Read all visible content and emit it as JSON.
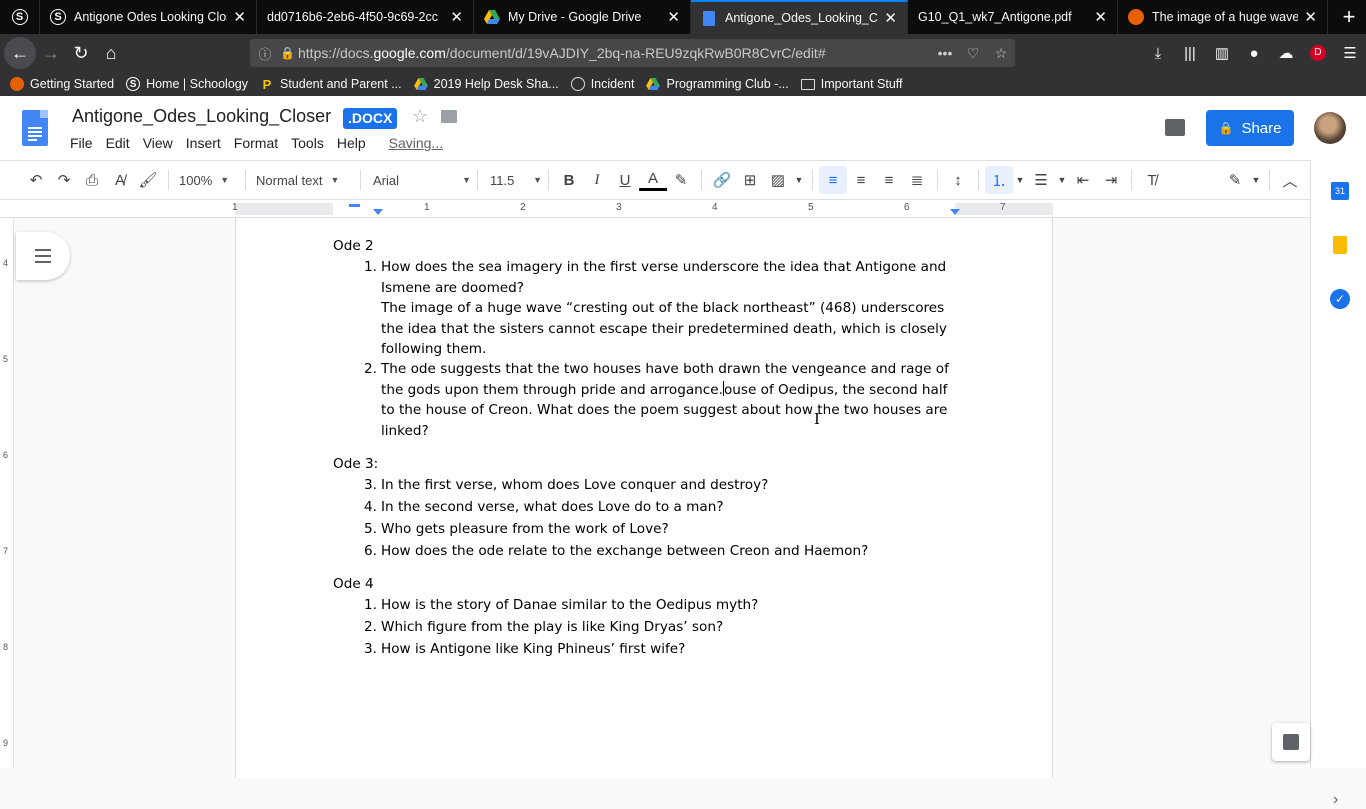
{
  "browser": {
    "tabs": [
      {
        "title": "Antigone Odes Looking Closer",
        "icon": "schoology-icon",
        "active": false
      },
      {
        "title": "dd0716b6-2eb6-4f50-9c69-2cc",
        "icon": "none",
        "active": false
      },
      {
        "title": "My Drive - Google Drive",
        "icon": "google-drive-icon",
        "active": false
      },
      {
        "title": "Antigone_Odes_Looking_Closer",
        "icon": "google-docs-icon",
        "active": true
      },
      {
        "title": "G10_Q1_wk7_Antigone.pdf",
        "icon": "none",
        "active": false
      },
      {
        "title": "The image of a huge wave \"cr",
        "icon": "firefox-icon",
        "active": false
      }
    ],
    "url_prefix": "https://docs.",
    "url_domain": "google.com",
    "url_rest": "/document/d/19vAJDIY_2bq-na-REU9zqkRwB0R8CvrC/edit#",
    "profile_initial": "D",
    "bookmarks": [
      {
        "label": "Getting Started",
        "icon": "firefox-icon"
      },
      {
        "label": "Home | Schoology",
        "icon": "schoology-icon"
      },
      {
        "label": "Student and Parent ...",
        "icon": "p-icon"
      },
      {
        "label": "2019 Help Desk Sha...",
        "icon": "google-drive-icon"
      },
      {
        "label": "Incident",
        "icon": "globe-icon"
      },
      {
        "label": "Programming Club -...",
        "icon": "google-drive-icon"
      },
      {
        "label": "Important Stuff",
        "icon": "folder-icon"
      }
    ]
  },
  "docs": {
    "title": "Antigone_Odes_Looking_Closer",
    "badge": ".DOCX",
    "menu": [
      "File",
      "Edit",
      "View",
      "Insert",
      "Format",
      "Tools",
      "Help"
    ],
    "status": "Saving...",
    "share_label": "Share",
    "toolbar": {
      "zoom": "100%",
      "style": "Normal text",
      "font": "Arial",
      "font_size": "11.5"
    },
    "ruler_numbers": [
      "1",
      "1",
      "2",
      "3",
      "4",
      "5",
      "6",
      "7"
    ],
    "vruler_numbers": [
      "4",
      "5",
      "6",
      "7",
      "8",
      "9"
    ],
    "calendar_label": "31"
  },
  "document": {
    "ode2": {
      "heading": "Ode 2",
      "items": [
        {
          "n": "1.",
          "text": "How does the sea imagery in the first verse underscore the idea that Antigone and Ismene are doomed?",
          "answer": "The image of a huge wave “cresting out of the black northeast” (468) underscores the idea that the sisters cannot escape their predetermined death, which is closely following them."
        },
        {
          "n": "2.",
          "text_a": "The ode suggests that the two houses have both drawn the vengeance and rage of the gods upon them through pride and arrogance.",
          "text_b": "ouse of Oedipus, the second half to the house of Creon.  What does the poem suggest about how the two houses are linked?"
        }
      ]
    },
    "ode3": {
      "heading": "Ode 3:",
      "items": [
        {
          "n": "3.",
          "text": "In the first verse, whom does Love conquer and destroy?"
        },
        {
          "n": "4.",
          "text": "In the second verse, what does Love do to a man?"
        },
        {
          "n": "5.",
          "text": "Who gets pleasure from the work of Love?"
        },
        {
          "n": "6.",
          "text": "How does the ode relate to the exchange between Creon and Haemon?"
        }
      ]
    },
    "ode4": {
      "heading": "Ode 4",
      "items": [
        {
          "n": "1.",
          "text": "How is the story of Danae similar to the Oedipus myth?"
        },
        {
          "n": "2.",
          "text": "Which figure from the play is like King Dryas’ son?"
        },
        {
          "n": "3.",
          "text": "How is Antigone like King Phineus’ first wife?"
        }
      ]
    }
  }
}
